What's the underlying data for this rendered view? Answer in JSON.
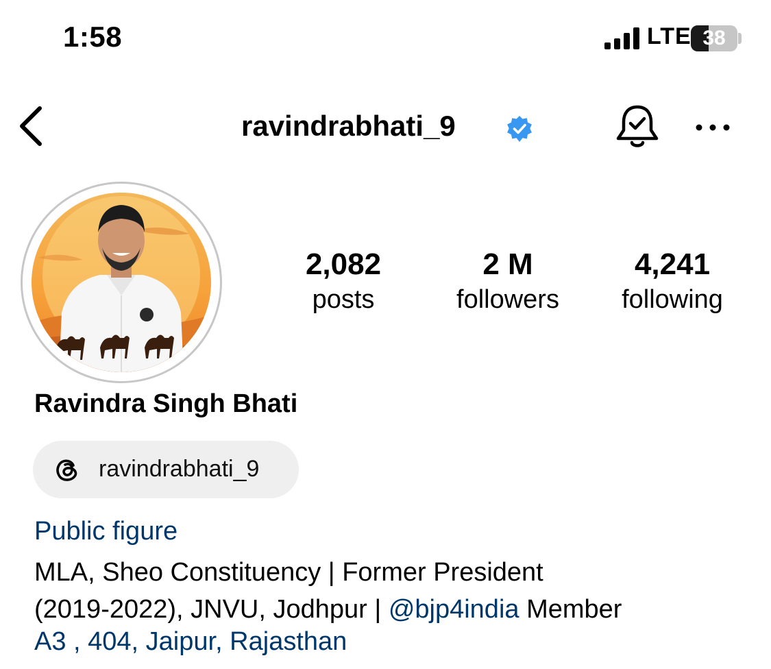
{
  "status_bar": {
    "time": "1:58",
    "network": "LTE",
    "battery": "38",
    "battery_level": 0.38
  },
  "header": {
    "username": "ravindrabhati_9",
    "verified": true,
    "icons": [
      "back-chevron-icon",
      "verified-badge-icon",
      "notification-bell-icon",
      "more-options-icon"
    ]
  },
  "profile": {
    "avatar": "profile-photo",
    "stats": [
      {
        "value": "2,082",
        "label": "posts"
      },
      {
        "value": "2 M",
        "label": "followers"
      },
      {
        "value": "4,241",
        "label": "following"
      }
    ],
    "full_name": "Ravindra Singh Bhati",
    "threads_handle": "ravindrabhati_9",
    "category": "Public figure",
    "bio_line1": "MLA, Sheo Constituency | Former President",
    "bio_line2_prefix": "(2019-2022), JNVU, Jodhpur | ",
    "bio_mention": "@bjp4india",
    "bio_line2_suffix": " Member",
    "address": "A3 , 404, Jaipur, Rajasthan"
  },
  "colors": {
    "link": "#00376b",
    "verified": "#3897f0",
    "pill_bg": "#efefef",
    "ring": "#c7c7c7"
  }
}
